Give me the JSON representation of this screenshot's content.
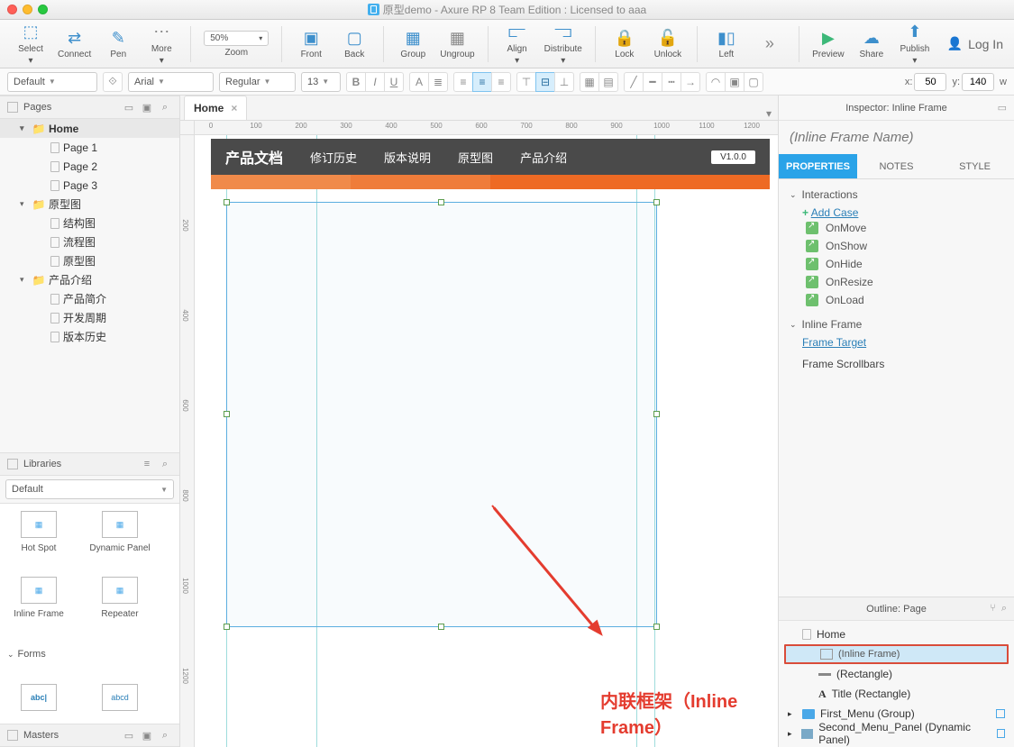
{
  "window": {
    "title": "原型demo - Axure RP 8 Team Edition : Licensed to aaa"
  },
  "toolbar": {
    "select": "Select",
    "connect": "Connect",
    "pen": "Pen",
    "more": "More",
    "zoom_value": "50%",
    "zoom_label": "Zoom",
    "front": "Front",
    "back": "Back",
    "group": "Group",
    "ungroup": "Ungroup",
    "align": "Align",
    "distribute": "Distribute",
    "lock": "Lock",
    "unlock": "Unlock",
    "left": "Left",
    "preview": "Preview",
    "share": "Share",
    "publish": "Publish",
    "login": "Log In"
  },
  "fmt": {
    "style": "Default",
    "font": "Arial",
    "weight": "Regular",
    "size": "13",
    "x_label": "x:",
    "x": "50",
    "y_label": "y:",
    "y": "140",
    "w_label": "w"
  },
  "pages": {
    "header": "Pages",
    "items": [
      {
        "label": "Home",
        "type": "folder",
        "active": true,
        "lvl": 0
      },
      {
        "label": "Page 1",
        "type": "page",
        "lvl": 1
      },
      {
        "label": "Page 2",
        "type": "page",
        "lvl": 1
      },
      {
        "label": "Page 3",
        "type": "page",
        "lvl": 1
      },
      {
        "label": "原型图",
        "type": "folder",
        "lvl": 0
      },
      {
        "label": "结构图",
        "type": "page",
        "lvl": 1
      },
      {
        "label": "流程图",
        "type": "page",
        "lvl": 1
      },
      {
        "label": "原型图",
        "type": "page",
        "lvl": 1
      },
      {
        "label": "产品介绍",
        "type": "folder",
        "lvl": 0
      },
      {
        "label": "产品简介",
        "type": "page",
        "lvl": 1
      },
      {
        "label": "开发周期",
        "type": "page",
        "lvl": 1
      },
      {
        "label": "版本历史",
        "type": "page",
        "lvl": 1
      }
    ]
  },
  "libraries": {
    "header": "Libraries",
    "dropdown": "Default",
    "widgets": [
      {
        "label": "Hot Spot"
      },
      {
        "label": "Dynamic Panel"
      },
      {
        "label": "Inline Frame"
      },
      {
        "label": "Repeater"
      }
    ],
    "forms_header": "Forms",
    "form_items": [
      {
        "label": "abc"
      },
      {
        "label": "abcd"
      }
    ]
  },
  "masters": {
    "header": "Masters"
  },
  "tabs": {
    "open": [
      {
        "label": "Home"
      }
    ]
  },
  "ruler_h": [
    "0",
    "100",
    "200",
    "300",
    "400",
    "500",
    "600",
    "700",
    "800",
    "900",
    "1000",
    "1100",
    "1200"
  ],
  "ruler_v": [
    "200",
    "400",
    "600",
    "800",
    "1000",
    "1200"
  ],
  "proto": {
    "logo": "产品文档",
    "nav": [
      "修订历史",
      "版本说明",
      "原型图",
      "产品介绍"
    ],
    "version": "V1.0.0"
  },
  "annotation": "内联框架（Inline Frame）",
  "inspector": {
    "header": "Inspector: Inline Frame",
    "name_placeholder": "(Inline Frame Name)",
    "tabs": {
      "properties": "PROPERTIES",
      "notes": "NOTES",
      "style": "STYLE"
    },
    "interactions": {
      "header": "Interactions",
      "add_case": "Add Case",
      "events": [
        "OnMove",
        "OnShow",
        "OnHide",
        "OnResize",
        "OnLoad"
      ]
    },
    "inline_frame": {
      "header": "Inline Frame",
      "frame_target": "Frame Target",
      "scrollbars": "Frame Scrollbars"
    }
  },
  "outline": {
    "header": "Outline: Page",
    "items": [
      {
        "label": "Home",
        "type": "page",
        "lvl": 0
      },
      {
        "label": "(Inline Frame)",
        "type": "frame",
        "lvl": 1,
        "selected": true
      },
      {
        "label": "(Rectangle)",
        "type": "rect",
        "lvl": 1
      },
      {
        "label": "Title (Rectangle)",
        "type": "text",
        "lvl": 1
      },
      {
        "label": "First_Menu (Group)",
        "type": "folder",
        "lvl": 0,
        "badge": true
      },
      {
        "label": "Second_Menu_Panel (Dynamic Panel)",
        "type": "dp",
        "lvl": 0,
        "badge": true
      }
    ]
  }
}
